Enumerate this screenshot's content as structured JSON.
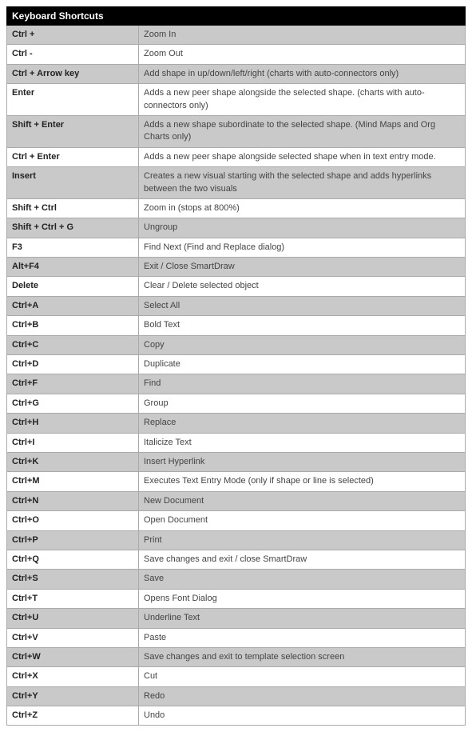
{
  "title": "Keyboard Shortcuts",
  "rows": [
    {
      "key": "Ctrl +",
      "desc": "Zoom In",
      "bg": "grey"
    },
    {
      "key": "Ctrl  -",
      "desc": "Zoom Out",
      "bg": "white"
    },
    {
      "key": "Ctrl + Arrow key",
      "desc": "Add shape in up/down/left/right  (charts with auto-connectors only)",
      "bg": "grey"
    },
    {
      "key": "Enter",
      "desc": "Adds a new peer shape alongside the selected shape. (charts with auto-connectors only)",
      "bg": "white"
    },
    {
      "key": "Shift + Enter",
      "desc": "Adds a new shape subordinate to the selected shape.  (Mind Maps and Org Charts only)",
      "bg": "grey"
    },
    {
      "key": "Ctrl + Enter",
      "desc": "Adds a new peer shape alongside selected shape when in text entry mode.",
      "bg": "white"
    },
    {
      "key": "Insert",
      "desc": "Creates a new visual starting with the selected shape and adds hyperlinks between the two visuals",
      "bg": "grey"
    },
    {
      "key": "Shift + Ctrl",
      "desc": "Zoom in (stops at 800%)",
      "bg": "white"
    },
    {
      "key": "Shift + Ctrl +  G",
      "desc": "Ungroup",
      "bg": "grey"
    },
    {
      "key": "F3",
      "desc": "Find Next (Find and Replace dialog)",
      "bg": "white"
    },
    {
      "key": "Alt+F4",
      "desc": "Exit / Close SmartDraw",
      "bg": "grey"
    },
    {
      "key": "Delete",
      "desc": "Clear / Delete selected object",
      "bg": "white"
    },
    {
      "key": "Ctrl+A",
      "desc": "Select All",
      "bg": "grey"
    },
    {
      "key": "Ctrl+B",
      "desc": "Bold Text",
      "bg": "white"
    },
    {
      "key": "Ctrl+C",
      "desc": "Copy",
      "bg": "grey"
    },
    {
      "key": "Ctrl+D",
      "desc": "Duplicate",
      "bg": "white"
    },
    {
      "key": "Ctrl+F",
      "desc": "Find",
      "bg": "grey"
    },
    {
      "key": "Ctrl+G",
      "desc": "Group",
      "bg": "white"
    },
    {
      "key": "Ctrl+H",
      "desc": "Replace",
      "bg": "grey"
    },
    {
      "key": "Ctrl+I",
      "desc": "Italicize Text",
      "bg": "white"
    },
    {
      "key": "Ctrl+K",
      "desc": "Insert Hyperlink",
      "bg": "grey"
    },
    {
      "key": "Ctrl+M",
      "desc": "Executes Text Entry Mode (only if shape or line is selected)",
      "bg": "white"
    },
    {
      "key": "Ctrl+N",
      "desc": "New Document",
      "bg": "grey"
    },
    {
      "key": "Ctrl+O",
      "desc": "Open Document",
      "bg": "white"
    },
    {
      "key": "Ctrl+P",
      "desc": "Print",
      "bg": "grey"
    },
    {
      "key": "Ctrl+Q",
      "desc": "Save changes and exit / close SmartDraw",
      "bg": "white"
    },
    {
      "key": "Ctrl+S",
      "desc": "Save",
      "bg": "grey"
    },
    {
      "key": "Ctrl+T",
      "desc": "Opens Font Dialog",
      "bg": "white"
    },
    {
      "key": "Ctrl+U",
      "desc": "Underline Text",
      "bg": "grey"
    },
    {
      "key": "Ctrl+V",
      "desc": "Paste",
      "bg": "white"
    },
    {
      "key": "Ctrl+W",
      "desc": "Save changes and exit to template selection screen",
      "bg": "grey"
    },
    {
      "key": "Ctrl+X",
      "desc": "Cut",
      "bg": "white"
    },
    {
      "key": "Ctrl+Y",
      "desc": "Redo",
      "bg": "grey"
    },
    {
      "key": "Ctrl+Z",
      "desc": "Undo",
      "bg": "white"
    }
  ]
}
